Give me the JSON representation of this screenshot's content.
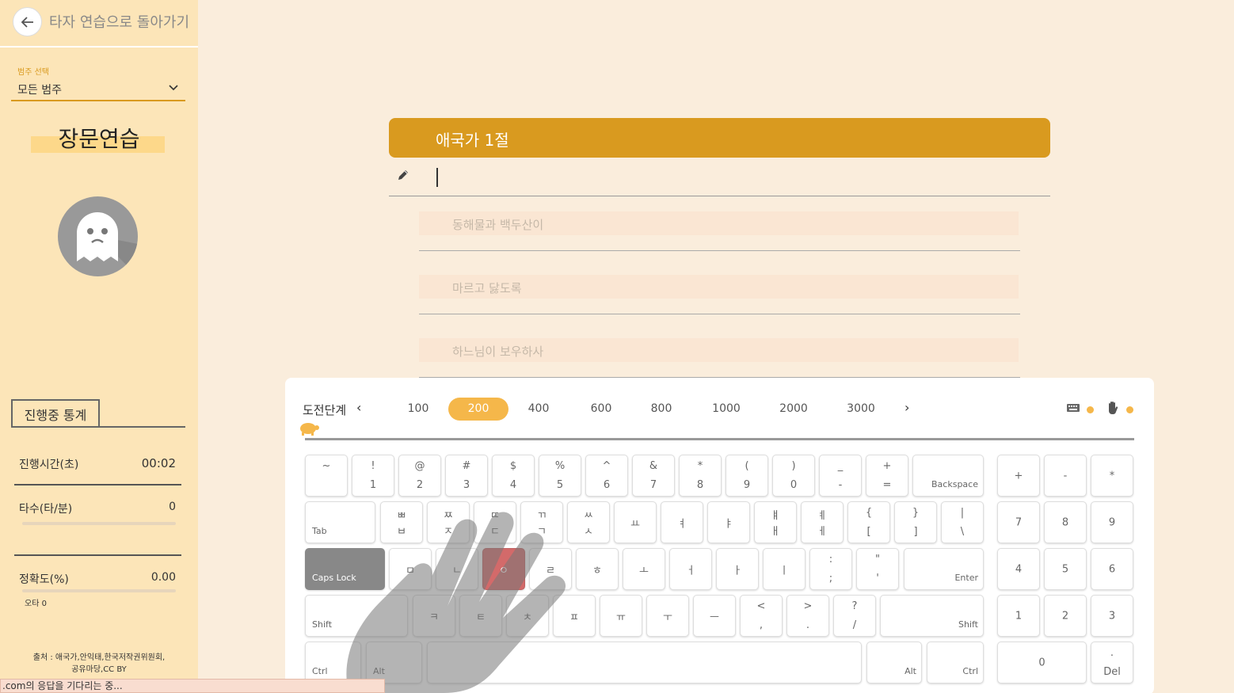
{
  "sidebar": {
    "back_label": "타자 연습으로 돌아가기",
    "category_caption": "범주 선택",
    "category_value": "모든 범주",
    "title": "장문연습",
    "stats_tab": "진행중 통계",
    "stats": {
      "time_label": "진행시간(초)",
      "time_value": "00:02",
      "speed_label": "타수(타/분)",
      "speed_value": "0",
      "accuracy_label": "정확도(%)",
      "accuracy_value": "0.00",
      "typo_label": "오타 0"
    },
    "source": "출처 : 애국가,안익태,한국저작권위원회,공유마당,CC BY"
  },
  "status_bar": ".com의 응답을 기다리는 중...",
  "practice": {
    "title": "애국가 1절",
    "input_value": "",
    "lines": [
      "동해물과 백두산이",
      "마르고 닳도록",
      "하느님이 보우하사"
    ]
  },
  "keyboard_panel": {
    "level_label": "도전단계",
    "levels": [
      "100",
      "200",
      "400",
      "600",
      "800",
      "1000",
      "2000",
      "3000"
    ],
    "active_level": "200",
    "keyboard_toggle_icon": "keyboard-icon",
    "hand_toggle_icon": "hand-icon",
    "accent": "#f5b74a",
    "highlight_key": "ㅇ"
  },
  "keys": {
    "row1": [
      [
        "~",
        ""
      ],
      [
        "!",
        "1"
      ],
      [
        "@",
        "2"
      ],
      [
        "#",
        "3"
      ],
      [
        "$",
        "4"
      ],
      [
        "%",
        "5"
      ],
      [
        "^",
        "6"
      ],
      [
        "&",
        "7"
      ],
      [
        "*",
        "8"
      ],
      [
        "(",
        "9"
      ],
      [
        ")",
        "0"
      ],
      [
        "_",
        "-"
      ],
      [
        "+",
        "="
      ]
    ],
    "backspace": "Backspace",
    "tab": "Tab",
    "row2": [
      [
        "ㅃ",
        "ㅂ"
      ],
      [
        "ㅉ",
        "ㅈ"
      ],
      [
        "ㄸ",
        "ㄷ"
      ],
      [
        "ㄲ",
        "ㄱ"
      ],
      [
        "ㅆ",
        "ㅅ"
      ],
      [
        "",
        "ㅛ"
      ],
      [
        "",
        "ㅕ"
      ],
      [
        "",
        "ㅑ"
      ],
      [
        "ㅒ",
        "ㅐ"
      ],
      [
        "ㅖ",
        "ㅔ"
      ],
      [
        "{",
        "["
      ],
      [
        "}",
        "]"
      ],
      [
        "|",
        "\\"
      ]
    ],
    "caps": "Caps Lock",
    "row3": [
      "ㅁ",
      "ㄴ",
      "ㅇ",
      "ㄹ",
      "ㅎ",
      "ㅗ",
      "ㅓ",
      "ㅏ",
      "ㅣ"
    ],
    "row3_punct": [
      [
        ":",
        ";"
      ],
      [
        "\"",
        "'"
      ]
    ],
    "enter": "Enter",
    "shift_l": "Shift",
    "row4": [
      "ㅋ",
      "ㅌ",
      "ㅊ",
      "ㅍ",
      "ㅠ",
      "ㅜ",
      "ㅡ"
    ],
    "row4_punct": [
      [
        "<",
        ","
      ],
      [
        ">",
        "."
      ],
      [
        "?",
        "/"
      ]
    ],
    "shift_r": "Shift",
    "ctrl": "Ctrl",
    "alt": "Alt",
    "numpad_top": [
      "+",
      "-",
      "*"
    ],
    "numpad_789": [
      "7",
      "8",
      "9"
    ],
    "numpad_456": [
      "4",
      "5",
      "6"
    ],
    "numpad_123": [
      "1",
      "2",
      "3"
    ],
    "numpad_0": "0",
    "numpad_del_top": ".",
    "numpad_del": "Del"
  }
}
